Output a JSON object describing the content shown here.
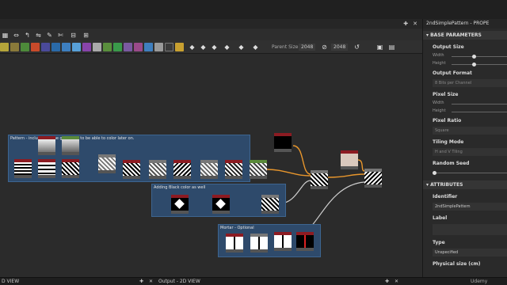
{
  "graph": {
    "toolbar": {
      "parent_size_label": "Parent Size:",
      "parent_size_value": "2048",
      "size_value": "2048"
    },
    "frames": [
      {
        "title": "Pattern - including some grayscale to be able to color later on."
      },
      {
        "title": "Adding Black color as well"
      },
      {
        "title": "Mortar - Optional"
      }
    ]
  },
  "properties": {
    "title": "2ndSimplePattern - PROPE",
    "sections": {
      "base": "BASE PARAMETERS",
      "attributes": "ATTRIBUTES"
    },
    "output_size": {
      "label": "Output Size",
      "width": "Width",
      "height": "Height"
    },
    "output_format": {
      "label": "Output Format",
      "value": "8 Bits per Channel"
    },
    "pixel_size": {
      "label": "Pixel Size",
      "width": "Width",
      "height": "Height"
    },
    "pixel_ratio": {
      "label": "Pixel Ratio",
      "value": "Square"
    },
    "tiling_mode": {
      "label": "Tiling Mode",
      "value": "H and V Tiling"
    },
    "random_seed": {
      "label": "Random Seed"
    },
    "identifier": {
      "label": "Identifier",
      "value": "2ndSimplePattern"
    },
    "label_field": {
      "label": "Label",
      "value": ""
    },
    "type": {
      "label": "Type",
      "value": "Unspecified"
    },
    "physical_size": {
      "label": "Physical size (cm)"
    }
  },
  "bottom": {
    "left_label": "D VIEW",
    "output_label": "Output - 2D VIEW",
    "brand": "Udemy"
  },
  "colors": {
    "frame": "#2e4a6b",
    "node_header_red": "#8c1b22",
    "edge_orange": "#e8962c",
    "edge_grey": "#bdbdbd"
  }
}
